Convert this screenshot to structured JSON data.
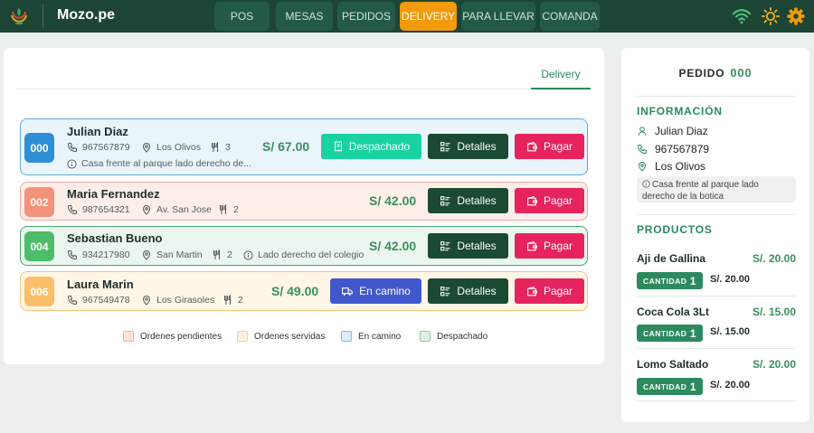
{
  "header": {
    "brand": "Mozo.pe",
    "nav": [
      {
        "label": "POS",
        "active": false
      },
      {
        "label": "MESAS",
        "active": false
      },
      {
        "label": "PEDIDOS",
        "active": false
      },
      {
        "label": "DELIVERY",
        "active": true
      },
      {
        "label": "PARA LLEVAR",
        "active": false
      },
      {
        "label": "COMANDA",
        "active": false
      }
    ],
    "icons": [
      "wifi-icon",
      "sun-icon",
      "gear-icon"
    ]
  },
  "main": {
    "tab": "Delivery",
    "orders": [
      {
        "code": "000",
        "name": "Julian Diaz",
        "phone": "967567879",
        "location": "Los Olivos",
        "items": "3",
        "note": "Casa frente al parque lado derecho de...",
        "total": "S/ 67.00",
        "status_label": "Despachado",
        "details_label": "Detalles",
        "pay_label": "Pagar"
      },
      {
        "code": "002",
        "name": "Maria Fernandez",
        "phone": "987654321",
        "location": "Av. San Jose",
        "items": "2",
        "total": "S/ 42.00",
        "details_label": "Detalles",
        "pay_label": "Pagar"
      },
      {
        "code": "004",
        "name": "Sebastian Bueno",
        "phone": "934217980",
        "location": "San Martin",
        "items": "2",
        "note": "Lado derecho del colegio",
        "total": "S/ 42.00",
        "details_label": "Detalles",
        "pay_label": "Pagar"
      },
      {
        "code": "006",
        "name": "Laura Marin",
        "phone": "967549478",
        "location": "Los Girasoles",
        "items": "2",
        "total": "S/ 49.00",
        "status_label": "En camino",
        "details_label": "Detalles",
        "pay_label": "Pagar"
      }
    ],
    "legend": [
      {
        "label": "Ordenes pendientes",
        "color": "#f8c7b6"
      },
      {
        "label": "Ordenes servidas",
        "color": "#fde0c0"
      },
      {
        "label": "En camino",
        "color": "#c9e2f5"
      },
      {
        "label": "Despachado",
        "color": "#c7e8d3"
      }
    ]
  },
  "sidebar": {
    "pedido_label": "PEDIDO",
    "pedido_num": "000",
    "info_title": "INFORMACIÓN",
    "name": "Julian Diaz",
    "phone": "967567879",
    "location": "Los Olivos",
    "note": "Casa frente al parque lado derecho de la botica",
    "products_title": "PRODUCTOS",
    "qty_label": "CANTIDAD",
    "products": [
      {
        "name": "Aji de Gallina",
        "price": "S/. 20.00",
        "qty": "1",
        "subtotal": "S/. 20.00"
      },
      {
        "name": "Coca Cola 3Lt",
        "price": "S/. 15.00",
        "qty": "1",
        "subtotal": "S/. 15.00"
      },
      {
        "name": "Lomo Saltado",
        "price": "S/. 20.00",
        "qty": "1",
        "subtotal": "S/. 20.00"
      }
    ]
  }
}
